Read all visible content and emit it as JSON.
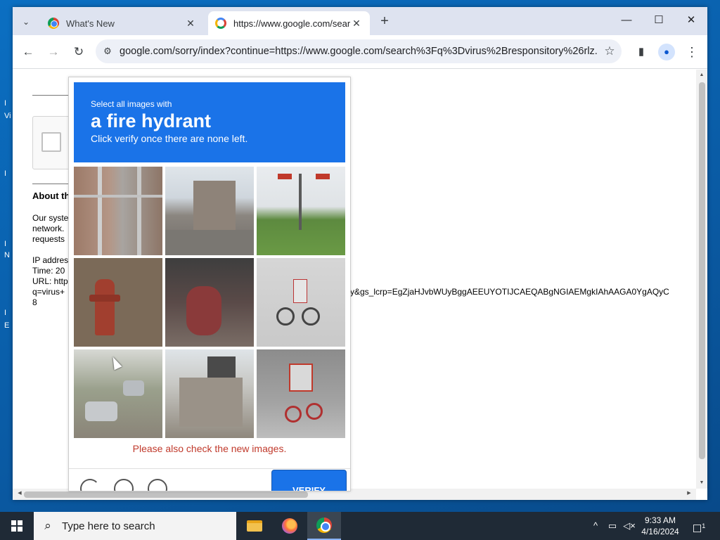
{
  "browser": {
    "tabs": [
      {
        "title": "What's New",
        "close": "✕"
      },
      {
        "title": "https://www.google.com/sear",
        "close": "✕"
      }
    ],
    "new_tab": "+",
    "window_controls": {
      "minimize": "—",
      "maximize": "☐",
      "close": "✕"
    },
    "url": "google.com/sorry/index?continue=https://www.google.com/search%3Fq%3Dvirus%2Bresponsitory%26rlz...",
    "icons": {
      "back": "back-arrow-icon",
      "forward": "forward-arrow-icon",
      "reload": "reload-icon",
      "site_info": "tune-icon",
      "bookmark": "star-icon",
      "side_panel": "side-panel-icon",
      "profile": "profile-icon",
      "menu": "kebab-menu-icon"
    }
  },
  "page": {
    "about_heading": "About th",
    "body_lines": [
      "Our syste",
      "network.",
      "requests"
    ],
    "info_lines": [
      "IP addres",
      "Time: 20",
      "URL: http",
      "q=virus+",
      "8"
    ],
    "url_tail": "ry&gs_lcrp=EgZjaHJvbWUyBggAEEUYOTIJCAEQABgNGIAEMgkIAhAAGA0YgAQyC"
  },
  "captcha": {
    "header": {
      "line1": "Select all images with",
      "line2": "a fire hydrant",
      "line3": "Click verify once there are none left."
    },
    "tiles": [
      "gate-door",
      "street-buildings",
      "traffic-light",
      "fire-hydrant",
      "motorcycle-rider",
      "bicycle-street",
      "cars-street",
      "building-rooftop",
      "bicycle-parked"
    ],
    "message": "Please also check the new images.",
    "verify_label": "VERIFY"
  },
  "taskbar": {
    "search_placeholder": "Type here to search",
    "time": "9:33 AM",
    "date": "4/16/2024",
    "notification_count": "1"
  },
  "colors": {
    "accent": "#1a73e8",
    "error": "#c0392b",
    "taskbar": "#1f2a36"
  }
}
